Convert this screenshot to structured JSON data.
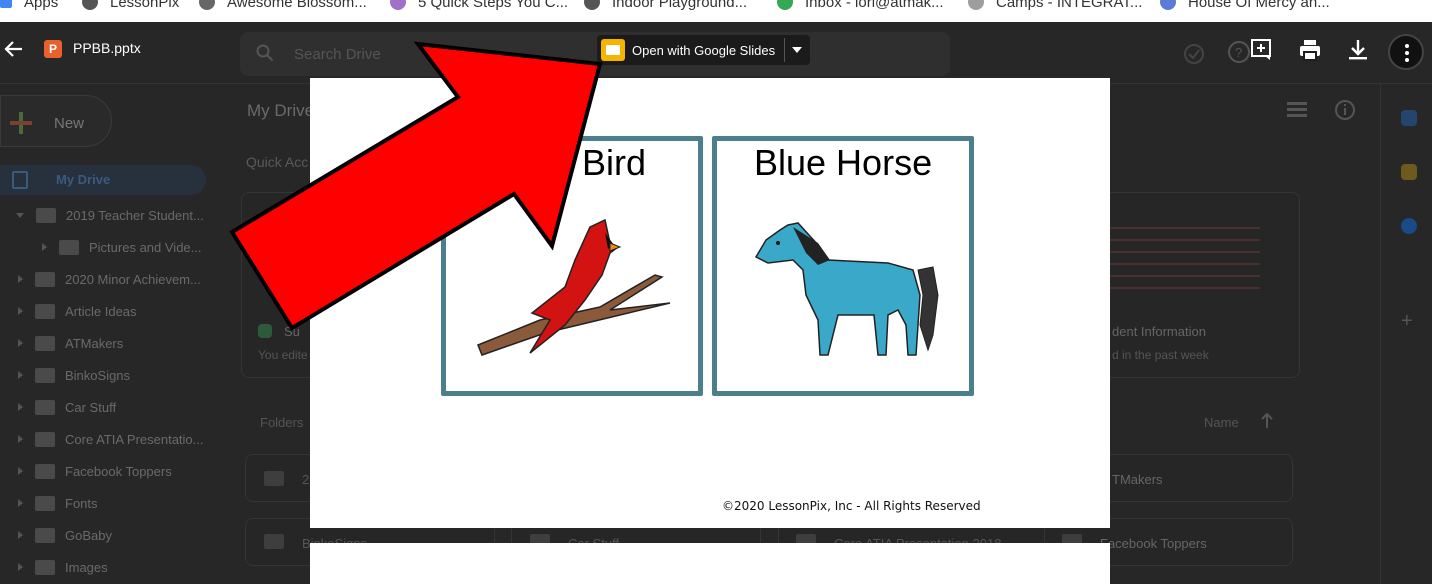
{
  "bookmarks": [
    {
      "label": "Apps",
      "color": "#4285f4"
    },
    {
      "label": "LessonPix",
      "color": "#555555"
    },
    {
      "label": "Awesome Blossom...",
      "color": "#666666"
    },
    {
      "label": "5 Quick Steps You C...",
      "color": "#a071c9"
    },
    {
      "label": "Indoor Playground...",
      "color": "#555555"
    },
    {
      "label": "Inbox - lori@atmak...",
      "color": "#34a853"
    },
    {
      "label": "Camps - INTEGRAT...",
      "color": "#9e9e9e"
    },
    {
      "label": "House Of Mercy an...",
      "color": "#5b7bd5"
    }
  ],
  "viewer": {
    "file_name": "PPBB.pptx",
    "file_icon_letter": "P",
    "open_with_label": "Open with Google Slides",
    "icons": [
      "back-arrow-icon",
      "add-comment-icon",
      "print-icon",
      "download-icon",
      "more-vert-icon"
    ]
  },
  "drive_background": {
    "search_placeholder": "Search Drive",
    "new_label": "New",
    "my_drive_nav": "My Drive",
    "my_drive_title": "My Drive",
    "quick_access": "Quick Acc",
    "folders_label": "Folders",
    "sort_label": "Name",
    "tree": [
      {
        "label": "2019 Teacher Student...",
        "level": 0,
        "open": true
      },
      {
        "label": "Pictures and Vide...",
        "level": 1,
        "open": false
      },
      {
        "label": "2020 Minor Achievem...",
        "level": 0,
        "open": false
      },
      {
        "label": "Article Ideas",
        "level": 0,
        "open": false
      },
      {
        "label": "ATMakers",
        "level": 0,
        "open": false
      },
      {
        "label": "BinkoSigns",
        "level": 0,
        "open": false
      },
      {
        "label": "Car Stuff",
        "level": 0,
        "open": false
      },
      {
        "label": "Core ATIA Presentatio...",
        "level": 0,
        "open": false
      },
      {
        "label": "Facebook Toppers",
        "level": 0,
        "open": false
      },
      {
        "label": "Fonts",
        "level": 0,
        "open": false
      },
      {
        "label": "GoBaby",
        "level": 0,
        "open": false
      },
      {
        "label": "Images",
        "level": 0,
        "open": false
      }
    ],
    "card_left_title": "Su",
    "card_left_sub": "You edite",
    "card_right_title": "dent Information",
    "card_right_sub": "d in the past week",
    "folder_chips": {
      "row1_left": "2",
      "row1_right": "TMakers",
      "row2": [
        "BinkoSigns",
        "Car Stuff",
        "Core ATIA Presentation 2018",
        "Facebook Toppers"
      ]
    }
  },
  "slide": {
    "cards": [
      {
        "title": "Bird",
        "image": "cardinal-on-branch"
      },
      {
        "title": "Blue Horse",
        "image": "blue-horse"
      }
    ],
    "copyright": "©2020 LessonPix, Inc - All Rights Reserved",
    "card_border_color": "#4c7f8c"
  },
  "overlay": {
    "arrow_color": "#ff0000"
  }
}
